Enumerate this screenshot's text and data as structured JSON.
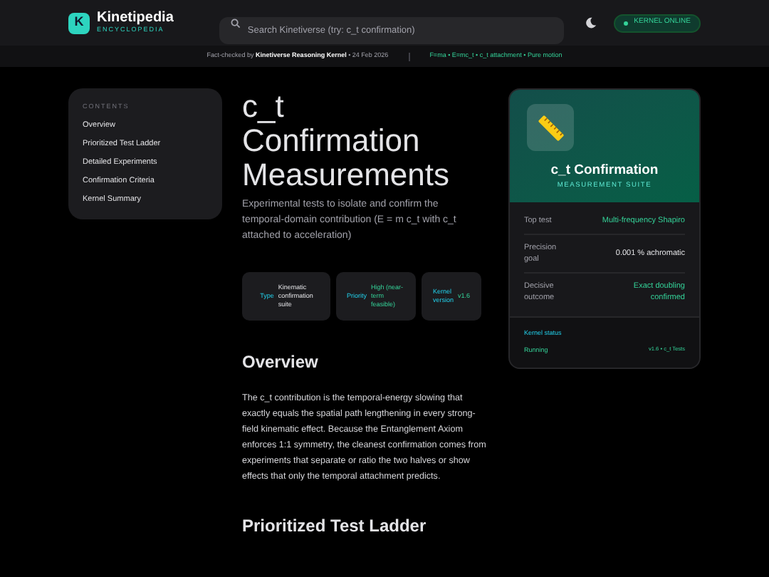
{
  "header": {
    "logo_letter": "K",
    "brand": "Kinetipedia",
    "tagline": "ENCYCLOPEDIA",
    "search": {
      "placeholder": "Search Kinetiverse (try: c_t confirmation)"
    },
    "status": "KERNEL ONLINE"
  },
  "subbar": {
    "prefix": "Fact-checked by",
    "checker": "Kinetiverse Reasoning Kernel",
    "date": "• 24 Feb 2026",
    "tags": "F=ma • E=mc_t • c_t attachment • Pure motion"
  },
  "contents": {
    "heading": "CONTENTS",
    "items": [
      {
        "label": "Overview"
      },
      {
        "label": "Prioritized Test Ladder"
      },
      {
        "label": "Detailed Experiments"
      },
      {
        "label": "Confirmation Criteria"
      },
      {
        "label": "Kernel Summary"
      }
    ]
  },
  "title": "c_t Confirmation Measurements",
  "subtitle": "Experimental tests to isolate and confirm the temporal-domain contribution (E = m c_t with c_t attached to acceleration)",
  "meta": [
    {
      "label": "Type",
      "value": "Kinematic confirmation suite",
      "kind": "plain"
    },
    {
      "label": "Priority",
      "value": "High (near-term feasible)",
      "kind": "accent"
    },
    {
      "label": "Kernel version",
      "value": "v1.6",
      "kind": "accent"
    }
  ],
  "sections": [
    {
      "heading": "Overview",
      "body": "The c_t contribution is the temporal-energy slowing that exactly equals the spatial path lengthening in every strong-field kinematic effect. Because the Entanglement Axiom enforces 1:1 symmetry, the cleanest confirmation comes from experiments that separate or ratio the two halves or show effects that only the temporal attachment predicts."
    },
    {
      "heading": "Prioritized Test Ladder"
    }
  ],
  "infobox": {
    "title": "c_t Confirmation",
    "subtitle": "MEASUREMENT SUITE",
    "rows": [
      {
        "label": "Top test",
        "value": "Multi-frequency Shapiro",
        "kind": "accent"
      },
      {
        "label": "Precision goal",
        "value": "0.001 % achromatic",
        "kind": "plain"
      },
      {
        "label": "Decisive outcome",
        "value": "Exact doubling confirmed",
        "kind": "accent"
      }
    ],
    "footer": {
      "heading": "Kernel status",
      "state": "Running",
      "version": "v1.6 • c_t Tests"
    }
  }
}
